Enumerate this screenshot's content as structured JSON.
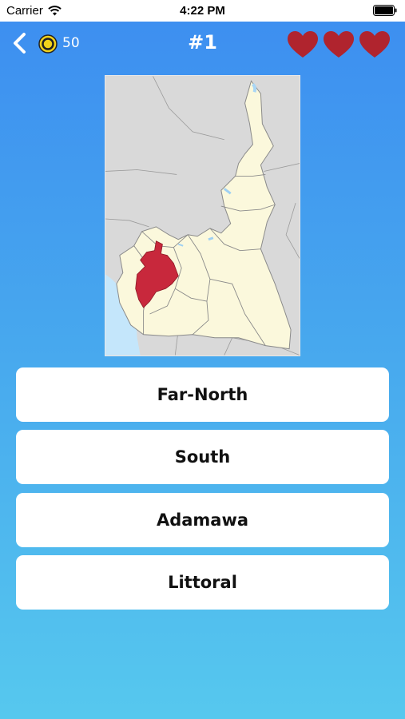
{
  "status_bar": {
    "carrier": "Carrier",
    "time": "4:22 PM"
  },
  "header": {
    "coins": "50",
    "question_number": "#1",
    "lives": 3,
    "heart_color": "#b0242e"
  },
  "map": {
    "highlight_color": "#c8283c",
    "land_color": "#fbf8dc",
    "water_color": "#c4e6fb"
  },
  "answers": [
    {
      "label": "Far-North"
    },
    {
      "label": "South"
    },
    {
      "label": "Adamawa"
    },
    {
      "label": "Littoral"
    }
  ],
  "colors": {
    "gradient_top": "#3d8ff0",
    "gradient_bottom": "#56c8ee"
  }
}
